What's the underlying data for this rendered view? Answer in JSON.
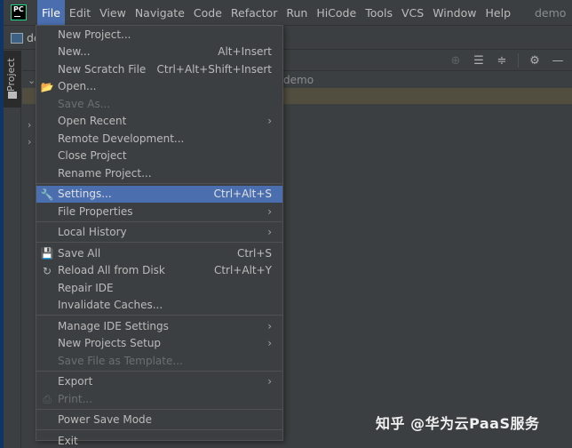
{
  "app": {
    "logo_text": "PC",
    "window_title": "demo"
  },
  "menubar": {
    "items": [
      {
        "label": "File",
        "active": true
      },
      {
        "label": "Edit"
      },
      {
        "label": "View"
      },
      {
        "label": "Navigate"
      },
      {
        "label": "Code"
      },
      {
        "label": "Refactor"
      },
      {
        "label": "Run"
      },
      {
        "label": "HiCode"
      },
      {
        "label": "Tools"
      },
      {
        "label": "VCS"
      },
      {
        "label": "Window"
      },
      {
        "label": "Help"
      }
    ]
  },
  "navbar": {
    "project_label": "demo"
  },
  "side_strip": {
    "project_tab_label": "Project"
  },
  "tool_header": {
    "icons": [
      "locate-icon",
      "expand-all-icon",
      "collapse-all-icon",
      "gear-icon",
      "minimize-icon"
    ]
  },
  "tree": {
    "root_label": "demo"
  },
  "file_menu": {
    "items": [
      {
        "label": "New Project...",
        "shortcut": "",
        "submenu": false,
        "disabled": false,
        "icon": ""
      },
      {
        "label": "New...",
        "shortcut": "Alt+Insert",
        "submenu": false,
        "disabled": false,
        "icon": ""
      },
      {
        "label": "New Scratch File",
        "shortcut": "Ctrl+Alt+Shift+Insert",
        "submenu": false,
        "disabled": false,
        "icon": ""
      },
      {
        "label": "Open...",
        "shortcut": "",
        "submenu": false,
        "disabled": false,
        "icon": "folder-open-icon"
      },
      {
        "label": "Save As...",
        "shortcut": "",
        "submenu": false,
        "disabled": true,
        "icon": ""
      },
      {
        "label": "Open Recent",
        "shortcut": "",
        "submenu": true,
        "disabled": false,
        "icon": ""
      },
      {
        "label": "Remote Development...",
        "shortcut": "",
        "submenu": false,
        "disabled": false,
        "icon": ""
      },
      {
        "label": "Close Project",
        "shortcut": "",
        "submenu": false,
        "disabled": false,
        "icon": ""
      },
      {
        "label": "Rename Project...",
        "shortcut": "",
        "submenu": false,
        "disabled": false,
        "icon": ""
      },
      {
        "label": "Settings...",
        "shortcut": "Ctrl+Alt+S",
        "submenu": false,
        "disabled": false,
        "icon": "wrench-icon",
        "highlighted": true
      },
      {
        "label": "File Properties",
        "shortcut": "",
        "submenu": true,
        "disabled": false,
        "icon": ""
      },
      {
        "label": "Local History",
        "shortcut": "",
        "submenu": true,
        "disabled": false,
        "icon": ""
      },
      {
        "label": "Save All",
        "shortcut": "Ctrl+S",
        "submenu": false,
        "disabled": false,
        "icon": "floppy-disk-icon"
      },
      {
        "label": "Reload All from Disk",
        "shortcut": "Ctrl+Alt+Y",
        "submenu": false,
        "disabled": false,
        "icon": "reload-icon"
      },
      {
        "label": "Repair IDE",
        "shortcut": "",
        "submenu": false,
        "disabled": false,
        "icon": ""
      },
      {
        "label": "Invalidate Caches...",
        "shortcut": "",
        "submenu": false,
        "disabled": false,
        "icon": ""
      },
      {
        "label": "Manage IDE Settings",
        "shortcut": "",
        "submenu": true,
        "disabled": false,
        "icon": ""
      },
      {
        "label": "New Projects Setup",
        "shortcut": "",
        "submenu": true,
        "disabled": false,
        "icon": ""
      },
      {
        "label": "Save File as Template...",
        "shortcut": "",
        "submenu": false,
        "disabled": true,
        "icon": ""
      },
      {
        "label": "Export",
        "shortcut": "",
        "submenu": true,
        "disabled": false,
        "icon": ""
      },
      {
        "label": "Print...",
        "shortcut": "",
        "submenu": false,
        "disabled": true,
        "icon": "printer-icon"
      },
      {
        "label": "Power Save Mode",
        "shortcut": "",
        "submenu": false,
        "disabled": false,
        "icon": ""
      },
      {
        "label": "Exit",
        "shortcut": "",
        "submenu": false,
        "disabled": false,
        "icon": ""
      }
    ]
  },
  "watermark": {
    "text": "知乎 @华为云PaaS服务"
  },
  "colors": {
    "highlight": "#4b6eaf",
    "background": "#3c3f41",
    "text": "#bbbbbb",
    "disabled_text": "#6c6f71",
    "selected_row": "#56533f"
  }
}
